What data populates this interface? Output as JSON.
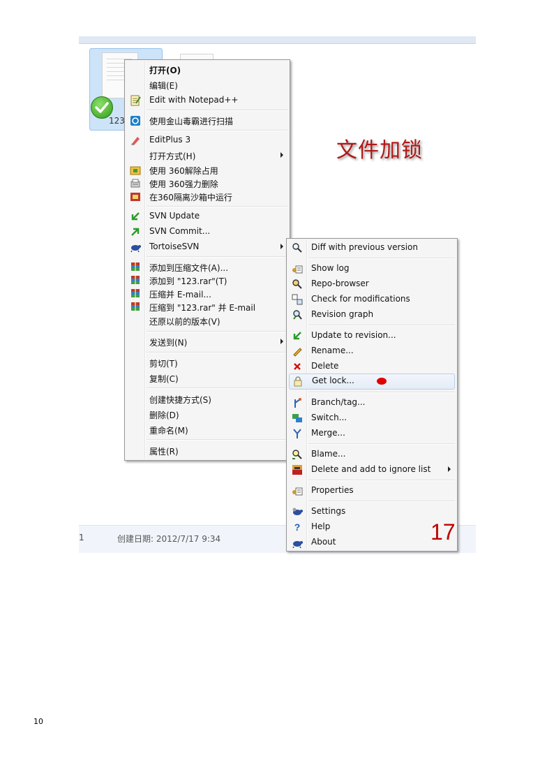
{
  "explorer": {
    "file_label": "123",
    "status_count": "1",
    "status_date": "创建日期: 2012/7/17 9:34"
  },
  "menu1": {
    "items": [
      {
        "label": "打开(O)",
        "icon": "none"
      },
      {
        "label": "编辑(E)",
        "icon": "none"
      },
      {
        "label": "Edit with Notepad++",
        "icon": "notepad-icon"
      },
      {
        "label": "使用金山毒霸进行扫描",
        "icon": "kingsoft-antivirus-icon"
      },
      {
        "label": "EditPlus 3",
        "icon": "editplus-icon"
      },
      {
        "label": "打开方式(H)",
        "icon": "none"
      },
      {
        "label": "使用 360解除占用",
        "icon": "360-unlock-icon"
      },
      {
        "label": "使用 360强力删除",
        "icon": "360-delete-icon"
      },
      {
        "label": "在360隔离沙箱中运行",
        "icon": "360-sandbox-icon"
      },
      {
        "label": "SVN Update",
        "icon": "svn-update-icon"
      },
      {
        "label": "SVN Commit...",
        "icon": "svn-commit-icon"
      },
      {
        "label": "TortoiseSVN",
        "icon": "tortoise-icon"
      },
      {
        "label": "添加到压缩文件(A)...",
        "icon": "winrar-icon"
      },
      {
        "label": "添加到 \"123.rar\"(T)",
        "icon": "winrar-icon"
      },
      {
        "label": "压缩并 E-mail...",
        "icon": "winrar-icon"
      },
      {
        "label": "压缩到 \"123.rar\" 并 E-mail",
        "icon": "winrar-icon"
      },
      {
        "label": "还原以前的版本(V)",
        "icon": "none"
      },
      {
        "label": "发送到(N)",
        "icon": "none"
      },
      {
        "label": "剪切(T)",
        "icon": "none"
      },
      {
        "label": "复制(C)",
        "icon": "none"
      },
      {
        "label": "创建快捷方式(S)",
        "icon": "none"
      },
      {
        "label": "删除(D)",
        "icon": "none"
      },
      {
        "label": "重命名(M)",
        "icon": "none"
      },
      {
        "label": "属性(R)",
        "icon": "none"
      }
    ]
  },
  "menu2": {
    "items": [
      {
        "label": "Diff with previous version",
        "icon": "diff-icon"
      },
      {
        "label": "Show log",
        "icon": "show-log-icon"
      },
      {
        "label": "Repo-browser",
        "icon": "repo-browser-icon"
      },
      {
        "label": "Check for modifications",
        "icon": "check-modifications-icon"
      },
      {
        "label": "Revision graph",
        "icon": "revision-graph-icon"
      },
      {
        "label": "Update to revision...",
        "icon": "update-revision-icon"
      },
      {
        "label": "Rename...",
        "icon": "rename-icon"
      },
      {
        "label": "Delete",
        "icon": "delete-icon"
      },
      {
        "label": "Get lock...",
        "icon": "lock-icon"
      },
      {
        "label": "Branch/tag...",
        "icon": "branch-icon"
      },
      {
        "label": "Switch...",
        "icon": "switch-icon"
      },
      {
        "label": "Merge...",
        "icon": "merge-icon"
      },
      {
        "label": "Blame...",
        "icon": "blame-icon"
      },
      {
        "label": "Delete and add to ignore list",
        "icon": "ignore-icon"
      },
      {
        "label": "Properties",
        "icon": "properties-icon"
      },
      {
        "label": "Settings",
        "icon": "settings-icon"
      },
      {
        "label": "Help",
        "icon": "help-icon"
      },
      {
        "label": "About",
        "icon": "about-icon"
      }
    ]
  },
  "annotation": {
    "title": "文件加锁",
    "step": "17"
  },
  "page": {
    "number": "10"
  },
  "colors": {
    "annotation_red": "#b01818",
    "highlight_border": "#b8cfe9",
    "selection_blue": "#cde3f8"
  }
}
